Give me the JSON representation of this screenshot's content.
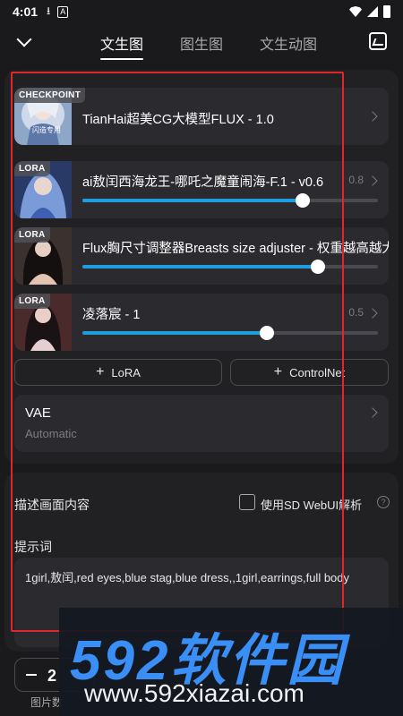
{
  "status_bar": {
    "time": "4:01",
    "download_icon": "download-icon",
    "a_icon": "A"
  },
  "top_nav": {
    "tabs": [
      {
        "label": "文生图",
        "active": true
      },
      {
        "label": "图生图",
        "active": false
      },
      {
        "label": "文生动图",
        "active": false
      }
    ]
  },
  "models": {
    "checkpoint": {
      "badge": "CHECKPOINT",
      "title": "TianHai超美CG大模型FLUX - 1.0",
      "thumb_caption": "闪造专用"
    },
    "loras": [
      {
        "badge": "LORA",
        "title": "ai敖闰西海龙王-哪吒之魔童闹海-F.1 - v0.6",
        "weight": "0.8",
        "level": 0.8
      },
      {
        "badge": "LORA",
        "title": "Flux胸尺寸调整器Breasts size adjuster - 权重越高越大",
        "weight": "",
        "level": 0.8
      },
      {
        "badge": "LORA",
        "title": "凌落宸 - 1",
        "weight": "0.5",
        "level": 0.63
      }
    ]
  },
  "buttons": {
    "add_lora": "LoRA",
    "add_controlnet": "ControlNet"
  },
  "vae": {
    "title": "VAE",
    "value": "Automatic"
  },
  "description": {
    "label": "描述画面内容",
    "sd_webui_label": "使用SD WebUI解析",
    "prompt_label": "提示词",
    "prompt_text": "1girl,敖闰,red eyes,blue stag,blue dress,,1girl,earrings,full body"
  },
  "bottom": {
    "count": "2",
    "count_label": "图片数"
  },
  "watermark": {
    "logo": "592软件园",
    "url": "www.592xiazai.com"
  },
  "colors": {
    "accent": "#1e9de0",
    "highlight": "#e0262b",
    "watermark_blue": "#3a8ff6"
  }
}
